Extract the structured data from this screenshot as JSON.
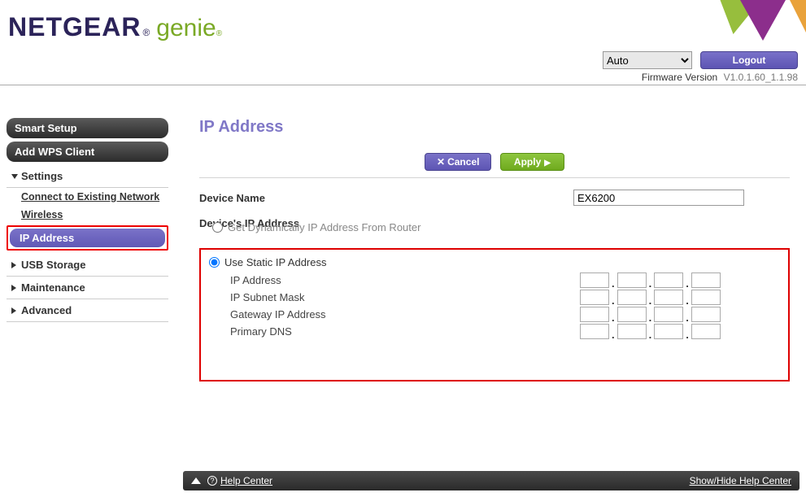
{
  "header": {
    "brand": "NETGEAR",
    "genie": "genie",
    "lang_selected": "Auto",
    "logout": "Logout",
    "fw_label": "Firmware Version",
    "fw_value": "V1.0.1.60_1.1.98"
  },
  "sidebar": {
    "smart_setup": "Smart Setup",
    "add_wps": "Add WPS Client",
    "settings": "Settings",
    "connect_existing": "Connect to Existing Network",
    "wireless": "Wireless",
    "ip_address": "IP Address",
    "usb": "USB Storage",
    "maintenance": "Maintenance",
    "advanced": "Advanced"
  },
  "page": {
    "title": "IP Address",
    "cancel": "Cancel",
    "apply": "Apply",
    "device_name_label": "Device Name",
    "device_name_value": "EX6200",
    "device_ip_label": "Device's IP Address",
    "opt_dynamic": "Get Dynamically IP Address From Router",
    "opt_static": "Use Static IP Address",
    "ip_address": "IP Address",
    "subnet": "IP Subnet Mask",
    "gateway": "Gateway IP Address",
    "dns": "Primary DNS"
  },
  "footer": {
    "help_center": "Help Center",
    "show_hide": "Show/Hide Help Center"
  }
}
